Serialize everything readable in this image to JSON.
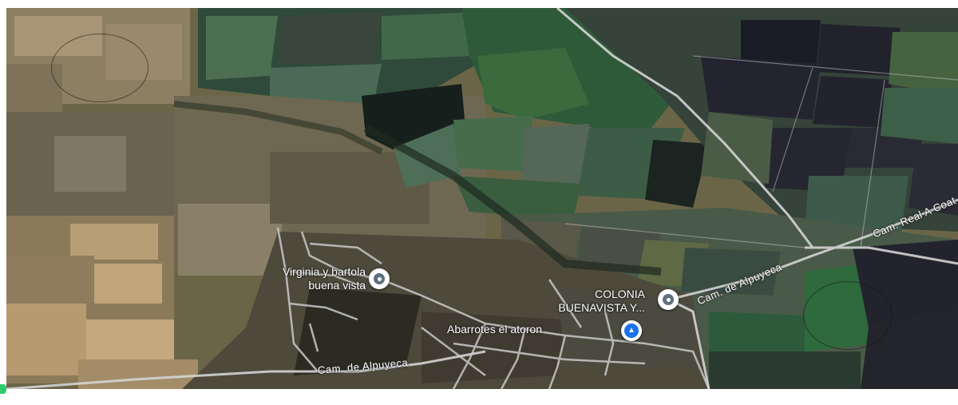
{
  "map": {
    "view": "satellite",
    "roads": {
      "south": "Cam. de Alpuyeca",
      "east": "Cam. de Alpuyeca",
      "northeast": "Cam. Real A Coat"
    },
    "places": [
      {
        "name": "Virginia y bartola buena vista",
        "lines": [
          "Virginia y bartola",
          "buena vista"
        ],
        "icon": "location-pin-icon"
      },
      {
        "name": "COLONIA BUENAVISTA Y...",
        "lines": [
          "COLONIA",
          "BUENAVISTA Y..."
        ],
        "icon": "location-pin-icon"
      },
      {
        "name": "Abarrotes el atoron",
        "lines": [
          "Abarrotes el atoron"
        ],
        "icon": "shopping-bag-icon"
      }
    ],
    "colors": {
      "pin": "#5f6f7d",
      "shop_pin": "#1a73e8",
      "road": "#c9c9c9",
      "label_text": "#ffffff"
    }
  }
}
